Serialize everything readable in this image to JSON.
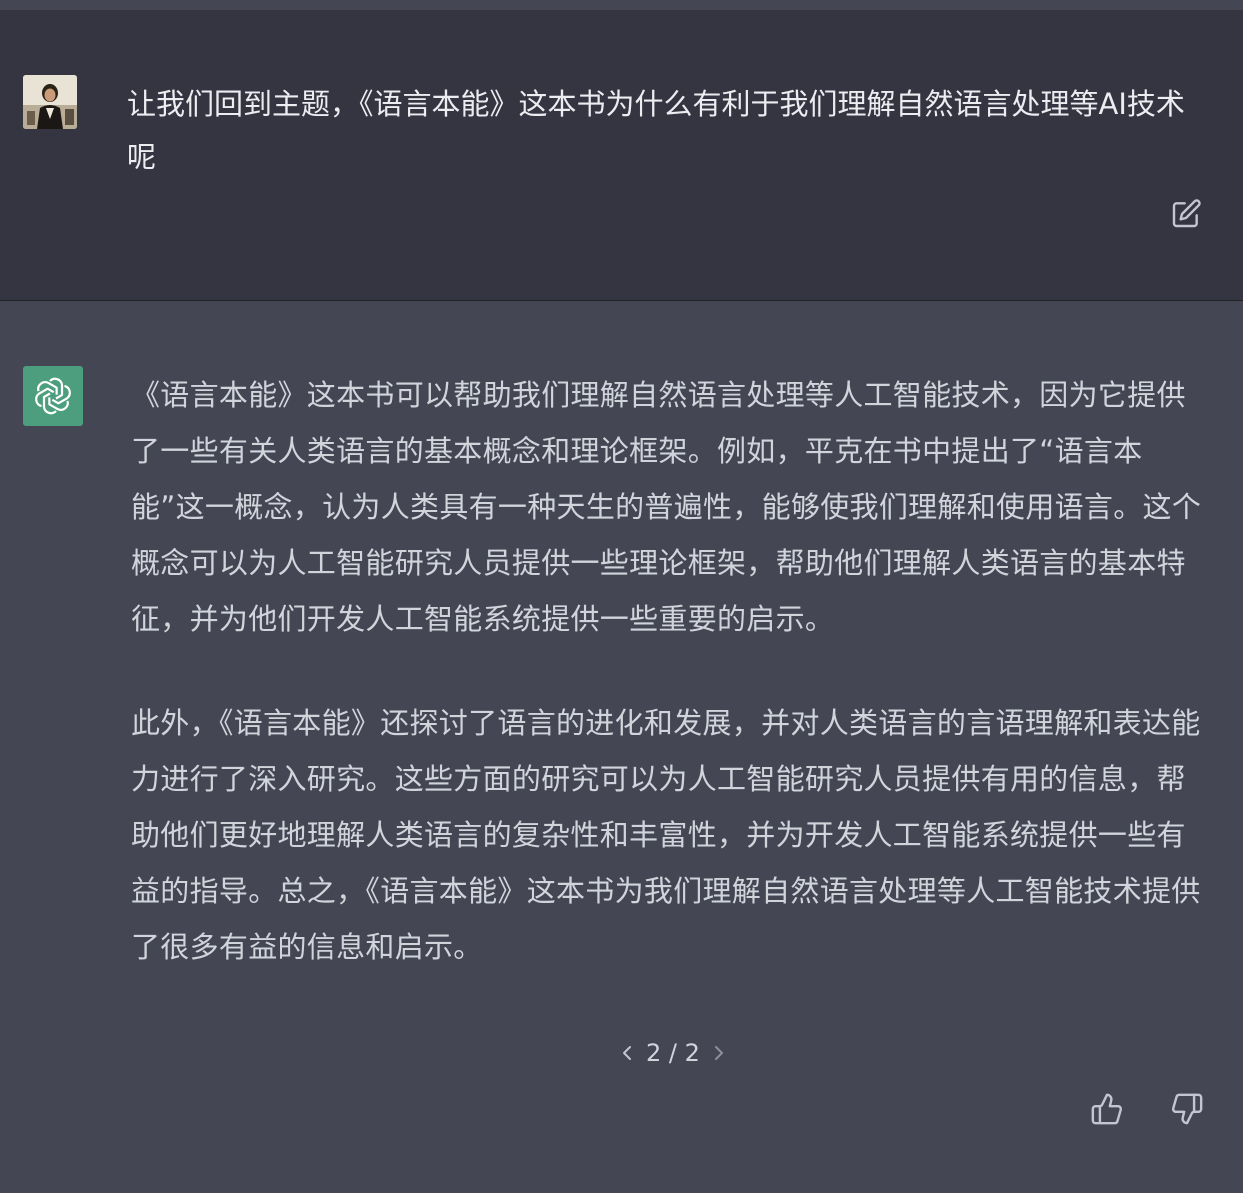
{
  "user_message": {
    "text": "让我们回到主题，《语言本能》这本书为什么有利于我们理解自然语言处理等AI技术呢",
    "avatar": "user-avatar-photo",
    "edit_icon": "edit-icon"
  },
  "assistant_message": {
    "avatar": "openai-logo-icon",
    "paragraphs": [
      "《语言本能》这本书可以帮助我们理解自然语言处理等人工智能技术，因为它提供了一些有关人类语言的基本概念和理论框架。例如，平克在书中提出了“语言本能”这一概念，认为人类具有一种天生的普遍性，能够使我们理解和使用语言。这个概念可以为人工智能研究人员提供一些理论框架，帮助他们理解人类语言的基本特征，并为他们开发人工智能系统提供一些重要的启示。",
      "此外，《语言本能》还探讨了语言的进化和发展，并对人类语言的言语理解和表达能力进行了深入研究。这些方面的研究可以为人工智能研究人员提供有用的信息，帮助他们更好地理解人类语言的复杂性和丰富性，并为开发人工智能系统提供一些有益的指导。总之，《语言本能》这本书为我们理解自然语言处理等人工智能技术提供了很多有益的信息和启示。"
    ],
    "pager": {
      "label": "2 / 2",
      "prev_icon": "chevron-left-icon",
      "next_icon": "chevron-right-icon"
    },
    "feedback": {
      "up_icon": "thumbs-up-icon",
      "down_icon": "thumbs-down-icon"
    }
  },
  "colors": {
    "user_bg": "#343541",
    "assistant_bg": "#444654",
    "text": "#d1d5db",
    "user_text": "#ececf1",
    "bot_avatar": "#4d9e7f"
  }
}
